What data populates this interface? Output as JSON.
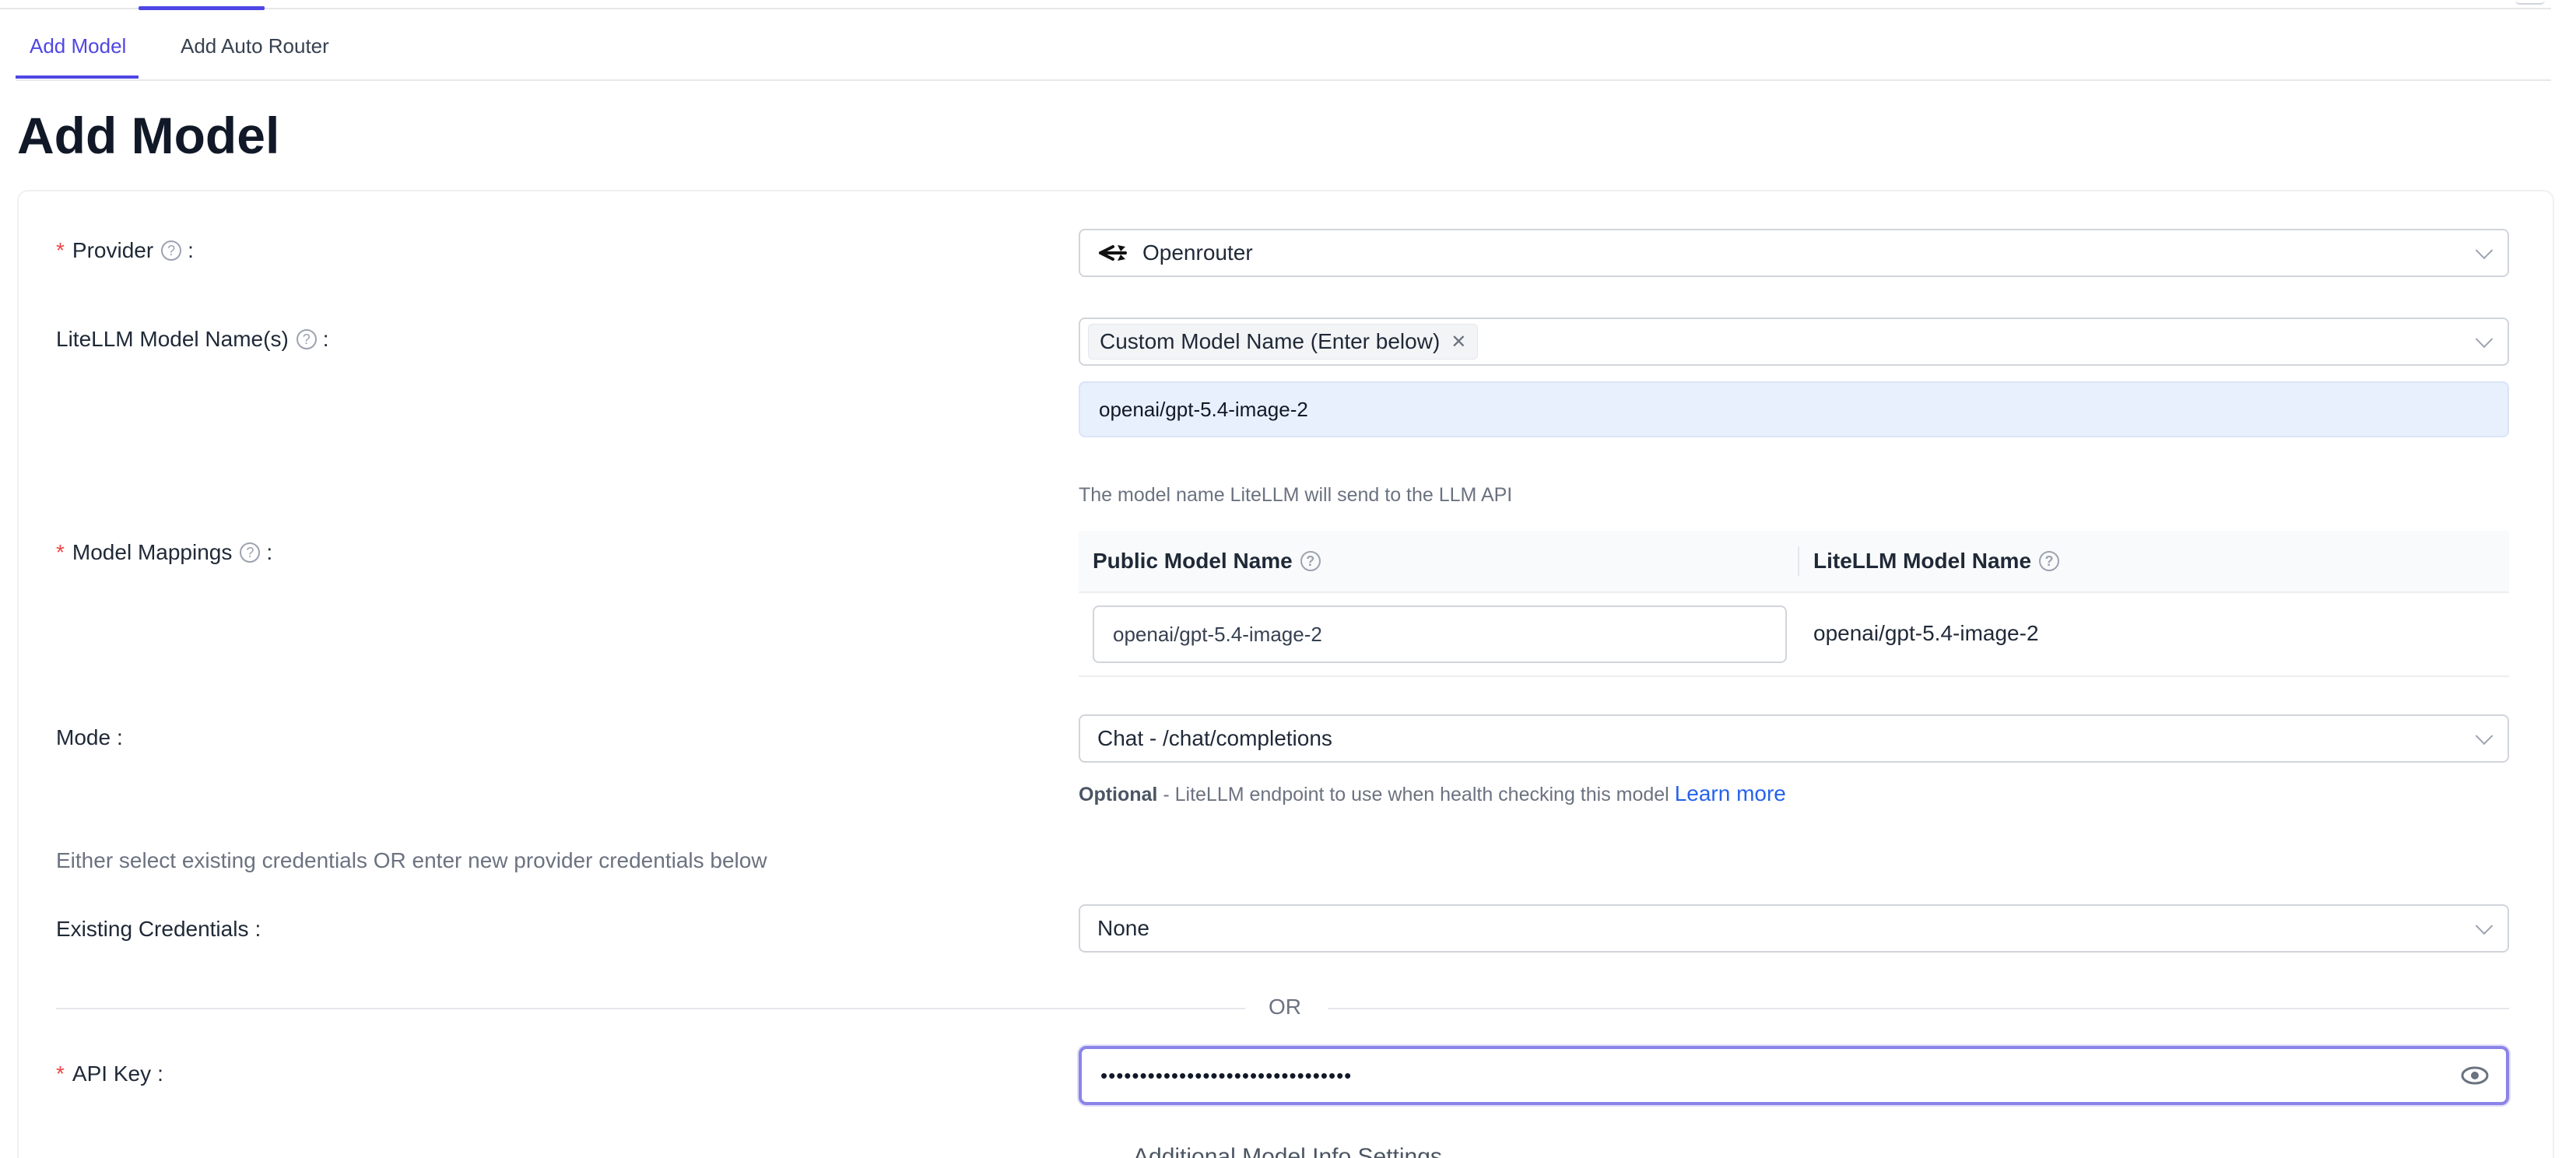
{
  "tabs": {
    "add_model": "Add Model",
    "add_auto_router": "Add Auto Router"
  },
  "page_title": "Add Model",
  "form": {
    "provider": {
      "label": "Provider",
      "value": "Openrouter",
      "icon": "openrouter-logo-icon"
    },
    "model_names": {
      "label": "LiteLLM Model Name(s)",
      "tag": "Custom Model Name (Enter below)",
      "custom_value": "openai/gpt-5.4-image-2",
      "hint": "The model name LiteLLM will send to the LLM API"
    },
    "model_mappings": {
      "label": "Model Mappings",
      "columns": [
        "Public Model Name",
        "LiteLLM Model Name"
      ],
      "rows": [
        {
          "public": "openai/gpt-5.4-image-2",
          "litellm": "openai/gpt-5.4-image-2"
        }
      ]
    },
    "mode": {
      "label": "Mode",
      "value": "Chat - /chat/completions",
      "hint_bold": "Optional",
      "hint_text": " - LiteLLM endpoint to use when health checking this model ",
      "hint_link": "Learn more"
    },
    "credentials_info": "Either select existing credentials OR enter new provider credentials below",
    "existing_credentials": {
      "label": "Existing Credentials",
      "value": "None"
    },
    "or_text": "OR",
    "api_key": {
      "label": "API Key",
      "value": "••••••••••••••••••••••••••••••••"
    },
    "additional_section": "Additional Model Info Settings"
  },
  "colors": {
    "accent": "#4f46e5",
    "required": "#ef4444",
    "link": "#2563eb"
  }
}
